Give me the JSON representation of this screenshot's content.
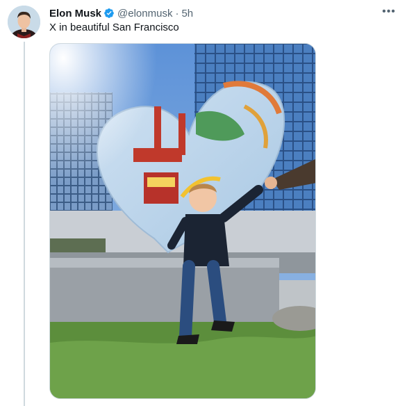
{
  "tweet": {
    "author_name": "Elon Musk",
    "handle": "@elonmusk",
    "separator": "·",
    "time": "5h",
    "text": "X in beautiful San Francisco",
    "more_label": "•••"
  },
  "icons": {
    "verified": "verified-badge-icon",
    "more": "more-options-icon"
  },
  "colors": {
    "verified_blue": "#1d9bf0",
    "secondary_text": "#536471",
    "primary_text": "#0f1419",
    "thread_line": "#cfd9de"
  }
}
